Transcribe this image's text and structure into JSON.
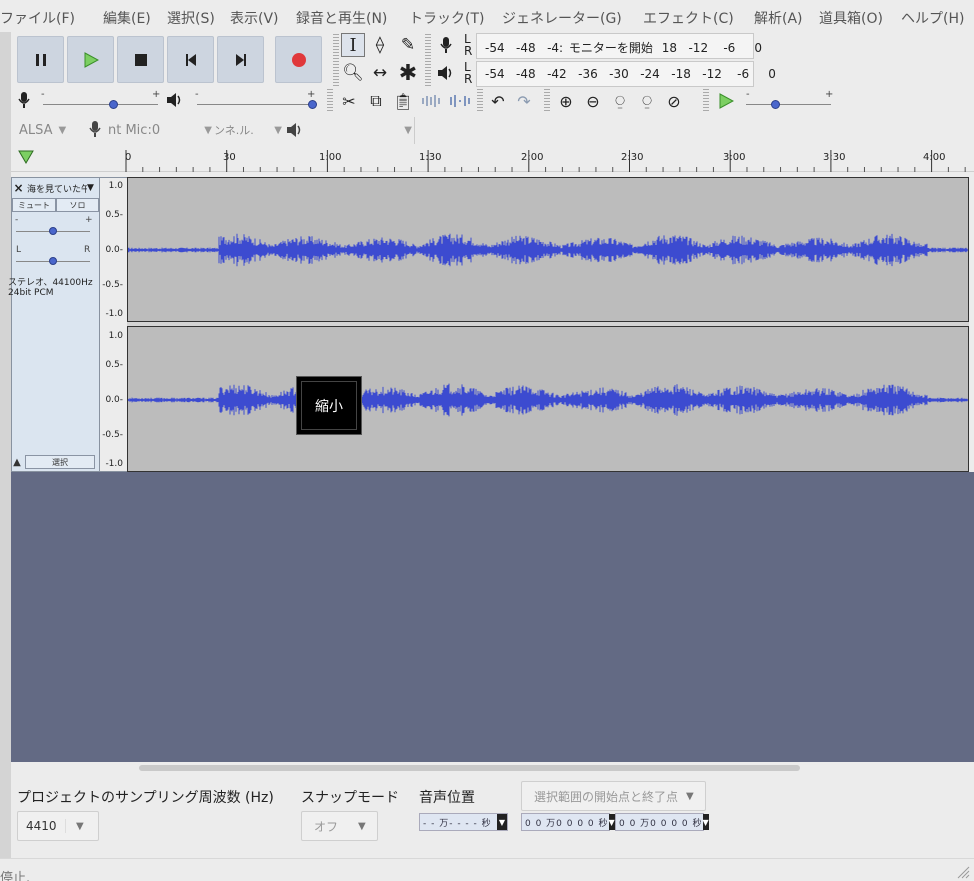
{
  "menu": [
    "ファイル(F)",
    "編集(E)",
    "選択(S)",
    "表示(V)",
    "録音と再生(N)",
    "トラック(T)",
    "ジェネレーター(G)",
    "エフェクト(C)",
    "解析(A)",
    "道具箱(O)",
    "ヘルプ(H)"
  ],
  "meters": {
    "record_scale": "-54   -48   -4:",
    "record_monitor": "モニターを開始",
    "record_tail": "18   -12    -6     0",
    "play_scale": "-54   -48   -42   -36   -30   -24   -18   -12    -6     0",
    "left": "L",
    "right": "R"
  },
  "slider_signs": {
    "minus": "-",
    "plus": "+"
  },
  "device": {
    "host": "ALSA",
    "input": "nt Mic:0",
    "channels": "ンネ.ル.",
    "output": ""
  },
  "timeline": {
    "labels": [
      "0",
      "30",
      "1:00",
      "1:30",
      "2:00",
      "2:30",
      "3:00",
      "3:30",
      "4:00"
    ]
  },
  "track": {
    "name": "海を見ていた午",
    "mute": "ミュート",
    "solo": "ソロ",
    "pan_left": "L",
    "pan_right": "R",
    "info_line1": "ステレオ、44100Hz",
    "info_line2": "24bit PCM",
    "select": "選択",
    "ruler": [
      "1.0",
      "0.5-",
      "0.0-",
      "-0.5-",
      "-1.0"
    ]
  },
  "tooltip": "縮小",
  "bottom": {
    "rate_label": "プロジェクトのサンプリング周波数 (Hz)",
    "rate_value": "4410",
    "snap_label": "スナップモード",
    "snap_value": "オフ",
    "audio_pos_label": "音声位置",
    "audio_pos_value": "- - 万- - - - 秒",
    "selection_label": "選択範囲の開始点と終了点",
    "sel_start": "0 0 万0 0 0 0 秒",
    "sel_end": "0 0 万0 0 0 0 秒"
  },
  "status": "停止.",
  "colors": {
    "waveform": "#3c4bd0",
    "empty_area": "#636a84",
    "record": "#e0383b",
    "play": "#4caf3a"
  }
}
